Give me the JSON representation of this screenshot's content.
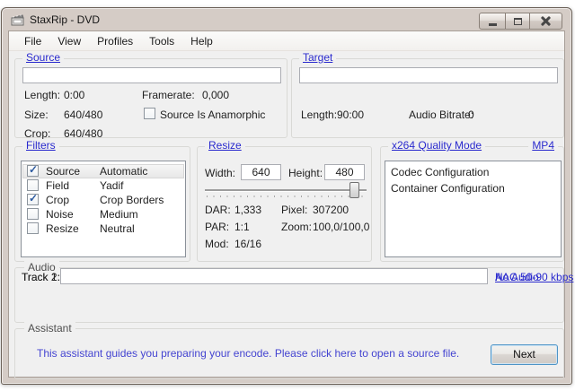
{
  "window": {
    "title": "StaxRip - DVD"
  },
  "menu": {
    "items": [
      {
        "label": "File",
        "name": "menu-item-file"
      },
      {
        "label": "View",
        "name": "menu-item-view"
      },
      {
        "label": "Profiles",
        "name": "menu-item-profiles"
      },
      {
        "label": "Tools",
        "name": "menu-item-tools"
      },
      {
        "label": "Help",
        "name": "menu-item-help"
      }
    ]
  },
  "source": {
    "title": "Source",
    "input_value": "",
    "length_label": "Length:",
    "length_value": "0:00",
    "framerate_label": "Framerate:",
    "framerate_value": "0,000",
    "size_label": "Size:",
    "size_value": "640/480",
    "anamorphic_label": "Source Is Anamorphic",
    "anamorphic_checked": false,
    "crop_label": "Crop:",
    "crop_value": "640/480"
  },
  "target": {
    "title": "Target",
    "input_value": "",
    "length_label": "Length:",
    "length_value": "90:00",
    "audio_bitrate_label": "Audio Bitrate:",
    "audio_bitrate_value": "0"
  },
  "filters": {
    "title": "Filters",
    "rows": [
      {
        "checked": true,
        "selected": true,
        "name": "Source",
        "value": "Automatic",
        "row_name": "filter-row-source"
      },
      {
        "checked": false,
        "selected": false,
        "name": "Field",
        "value": "Yadif",
        "row_name": "filter-row-field"
      },
      {
        "checked": true,
        "selected": false,
        "name": "Crop",
        "value": "Crop Borders",
        "row_name": "filter-row-crop"
      },
      {
        "checked": false,
        "selected": false,
        "name": "Noise",
        "value": "Medium",
        "row_name": "filter-row-noise"
      },
      {
        "checked": false,
        "selected": false,
        "name": "Resize",
        "value": "Neutral",
        "row_name": "filter-row-resize"
      }
    ]
  },
  "resize": {
    "title": "Resize",
    "width_label": "Width:",
    "width_value": "640",
    "height_label": "Height:",
    "height_value": "480",
    "slider_percent": 93,
    "dar_label": "DAR:",
    "dar_value": "1,333",
    "pixel_label": "Pixel:",
    "pixel_value": "307200",
    "par_label": "PAR:",
    "par_value": "1:1",
    "zoom_label": "Zoom:",
    "zoom_value": "100,0/100,0",
    "mod_label": "Mod:",
    "mod_value": "16/16"
  },
  "codec": {
    "title": "x264 Quality Mode",
    "container_link": "MP4",
    "items": [
      "Codec Configuration",
      "Container Configuration"
    ]
  },
  "audio": {
    "title": "Audio",
    "tracks": [
      {
        "label": "Track 1:",
        "input_value": "",
        "link": "AAC 50-90 kbps",
        "link_name": "track1-profile-link"
      },
      {
        "label": "Track 2:",
        "input_value": "",
        "link": "No Audio",
        "link_name": "track2-profile-link"
      }
    ]
  },
  "assistant": {
    "title": "Assistant",
    "message": "This assistant guides you preparing your encode. Please click here to open a source file.",
    "next_label": "Next"
  },
  "colors": {
    "titlebar": "#d5ccc6",
    "content_bg": "#f0f0f0",
    "link": "#2a2ace",
    "assistant_text": "#4444d1",
    "selection_check": "#2c5aa0",
    "focus_button_border": "#4e94c6"
  }
}
